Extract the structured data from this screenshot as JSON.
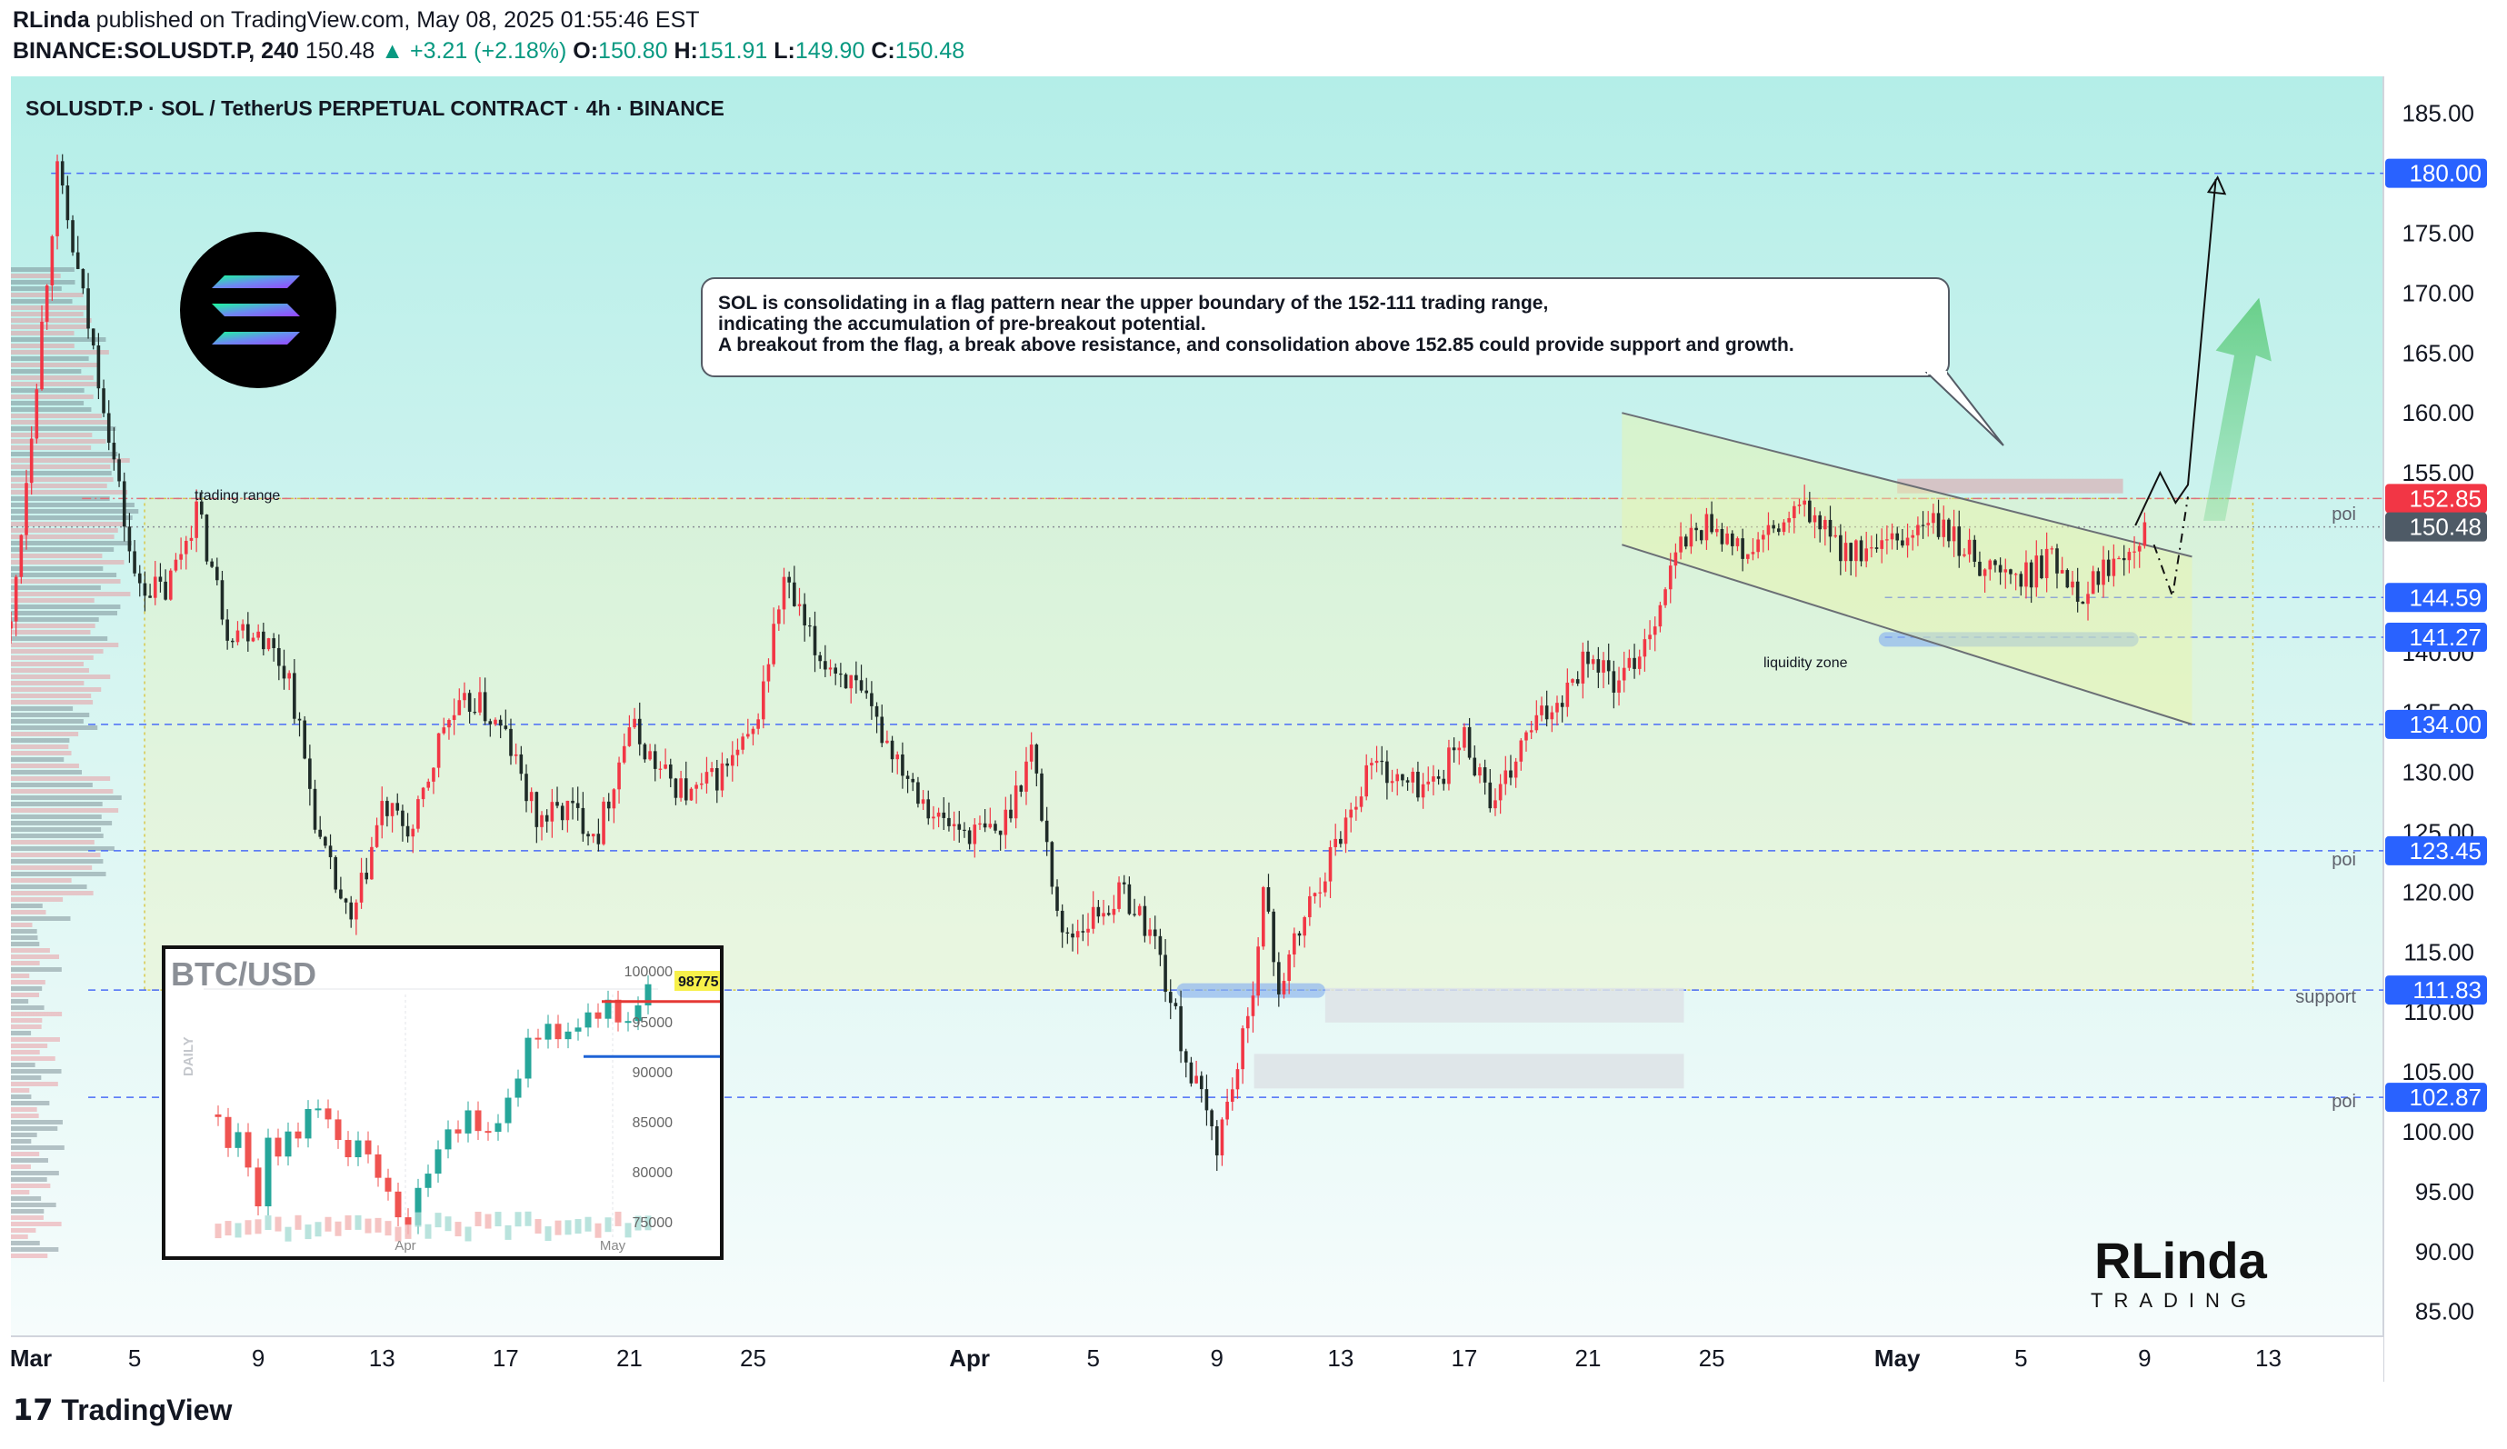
{
  "header": {
    "author": "RLinda",
    "published": "published on TradingView.com, May 08, 2025 01:55:46 EST",
    "symbol": "BINANCE:SOLUSDT.P, 240",
    "last": "150.48",
    "change": "▲ +3.21 (+2.18%)",
    "o_label": "O:",
    "o": "150.80",
    "h_label": "H:",
    "h": "151.91",
    "l_label": "L:",
    "l": "149.90",
    "c_label": "C:",
    "c": "150.48"
  },
  "chart_title": "SOLUSDT.P · SOL / TetherUS PERPETUAL CONTRACT · 4h · BINANCE",
  "annotation": {
    "line1": "SOL is consolidating in a flag pattern near the upper boundary of the 152-111 trading range,",
    "line2": "indicating the accumulation of pre-breakout potential.",
    "line3": "A breakout from the flag, a break above resistance, and consolidation above 152.85 could provide support and growth."
  },
  "labels": {
    "trading_range": "trading range",
    "liquidity_zone": "liquidity zone",
    "poi": "poi",
    "support": "support"
  },
  "inset": {
    "title": "BTC/USD",
    "side_label": "DAILY",
    "price_tag": "98775",
    "yticks": [
      "100000",
      "95000",
      "90000",
      "85000",
      "80000",
      "75000"
    ],
    "xticks": [
      "Apr",
      "May"
    ]
  },
  "branding": {
    "logo_main": "RLinda",
    "logo_sub": "TRADING",
    "footer": "TradingView"
  },
  "colors": {
    "bg_top": "#b7efe9",
    "bg_bottom": "#f3fbfb",
    "up": "#f23645",
    "down": "#1f2b28",
    "level_line": "#4a6cf7",
    "tag_blue": "#2962ff",
    "tag_red": "#f23645",
    "tag_grey": "#4e5a66"
  },
  "chart_data": {
    "type": "candlestick",
    "title": "SOLUSDT.P · SOL / TetherUS PERPETUAL CONTRACT · 4h · BINANCE",
    "ylim": [
      83,
      188
    ],
    "yticks": [
      85,
      90,
      95,
      100,
      105,
      110,
      115,
      120,
      125,
      130,
      135,
      140,
      145,
      150,
      155,
      160,
      165,
      170,
      175,
      180,
      185
    ],
    "ytick_labels": [
      "85.00",
      "90.00",
      "95.00",
      "100.00",
      "105.00",
      "110.00",
      "115.00",
      "120.00",
      "125.00",
      "130.00",
      "135.00",
      "140.00",
      "145.00",
      "150.00",
      "155.00",
      "160.00",
      "165.00",
      "170.00",
      "175.00",
      "180.00",
      "185.00"
    ],
    "xticks": [
      "Mar",
      "5",
      "9",
      "13",
      "17",
      "21",
      "25",
      "Apr",
      "5",
      "9",
      "13",
      "17",
      "21",
      "25",
      "May",
      "5",
      "9",
      "13"
    ],
    "xtick_days": [
      0,
      4,
      8,
      12,
      16,
      20,
      24,
      31,
      35,
      39,
      43,
      47,
      51,
      55,
      61,
      65,
      69,
      73
    ],
    "price_path": [
      [
        0,
        142
      ],
      [
        1.5,
        180
      ],
      [
        3,
        161
      ],
      [
        4,
        146
      ],
      [
        5,
        145
      ],
      [
        6,
        152
      ],
      [
        7,
        142
      ],
      [
        8,
        142
      ],
      [
        9,
        138
      ],
      [
        10,
        124
      ],
      [
        11,
        117
      ],
      [
        12,
        127
      ],
      [
        13,
        125
      ],
      [
        14,
        134
      ],
      [
        15,
        136
      ],
      [
        16,
        133
      ],
      [
        17,
        126
      ],
      [
        18,
        127
      ],
      [
        19,
        125
      ],
      [
        20,
        134
      ],
      [
        21,
        130
      ],
      [
        22,
        128
      ],
      [
        23,
        130
      ],
      [
        24,
        133
      ],
      [
        25,
        146
      ],
      [
        26,
        140
      ],
      [
        27,
        138
      ],
      [
        28,
        134
      ],
      [
        29,
        130
      ],
      [
        30,
        126
      ],
      [
        31,
        125
      ],
      [
        32,
        125
      ],
      [
        33,
        132
      ],
      [
        34,
        116
      ],
      [
        35,
        118
      ],
      [
        36,
        120
      ],
      [
        37,
        116
      ],
      [
        38,
        106
      ],
      [
        39,
        99
      ],
      [
        40,
        109
      ],
      [
        40.5,
        120
      ],
      [
        41,
        112
      ],
      [
        42,
        119
      ],
      [
        43,
        125
      ],
      [
        44,
        131
      ],
      [
        45,
        129
      ],
      [
        46,
        129
      ],
      [
        47,
        133
      ],
      [
        48,
        127
      ],
      [
        49,
        133
      ],
      [
        50,
        136
      ],
      [
        51,
        140
      ],
      [
        52,
        137
      ],
      [
        53,
        142
      ],
      [
        54,
        149
      ],
      [
        55,
        151
      ],
      [
        56,
        148
      ],
      [
        57,
        150
      ],
      [
        58,
        152
      ],
      [
        59,
        149
      ],
      [
        60,
        148
      ],
      [
        61,
        149
      ],
      [
        62,
        151
      ],
      [
        63,
        149
      ],
      [
        64,
        147
      ],
      [
        65,
        146
      ],
      [
        66,
        148
      ],
      [
        67,
        145
      ],
      [
        68,
        148
      ],
      [
        69,
        150.5
      ]
    ],
    "levels": [
      {
        "value": 180.0,
        "label": "180.00",
        "tag": "blue"
      },
      {
        "value": 152.85,
        "label": "152.85",
        "tag": "red",
        "note": "poi"
      },
      {
        "value": 150.48,
        "label": "150.48",
        "tag": "grey"
      },
      {
        "value": 144.59,
        "label": "144.59",
        "tag": "blue"
      },
      {
        "value": 141.27,
        "label": "141.27",
        "tag": "blue"
      },
      {
        "value": 134.0,
        "label": "134.00",
        "tag": "blue"
      },
      {
        "value": 123.45,
        "label": "123.45",
        "tag": "blue",
        "note": "poi"
      },
      {
        "value": 111.83,
        "label": "111.83",
        "tag": "blue",
        "note": "support"
      },
      {
        "value": 102.87,
        "label": "102.87",
        "tag": "blue",
        "note": "poi"
      }
    ],
    "trading_range": {
      "top": 152.85,
      "bottom": 111.83,
      "start_day": 3.5,
      "end_day": 72.5
    },
    "flag_channel": {
      "start_day": 52,
      "end_day": 72,
      "upper_start": 160,
      "upper_end": 148,
      "lower_start": 149,
      "lower_end": 134
    }
  }
}
